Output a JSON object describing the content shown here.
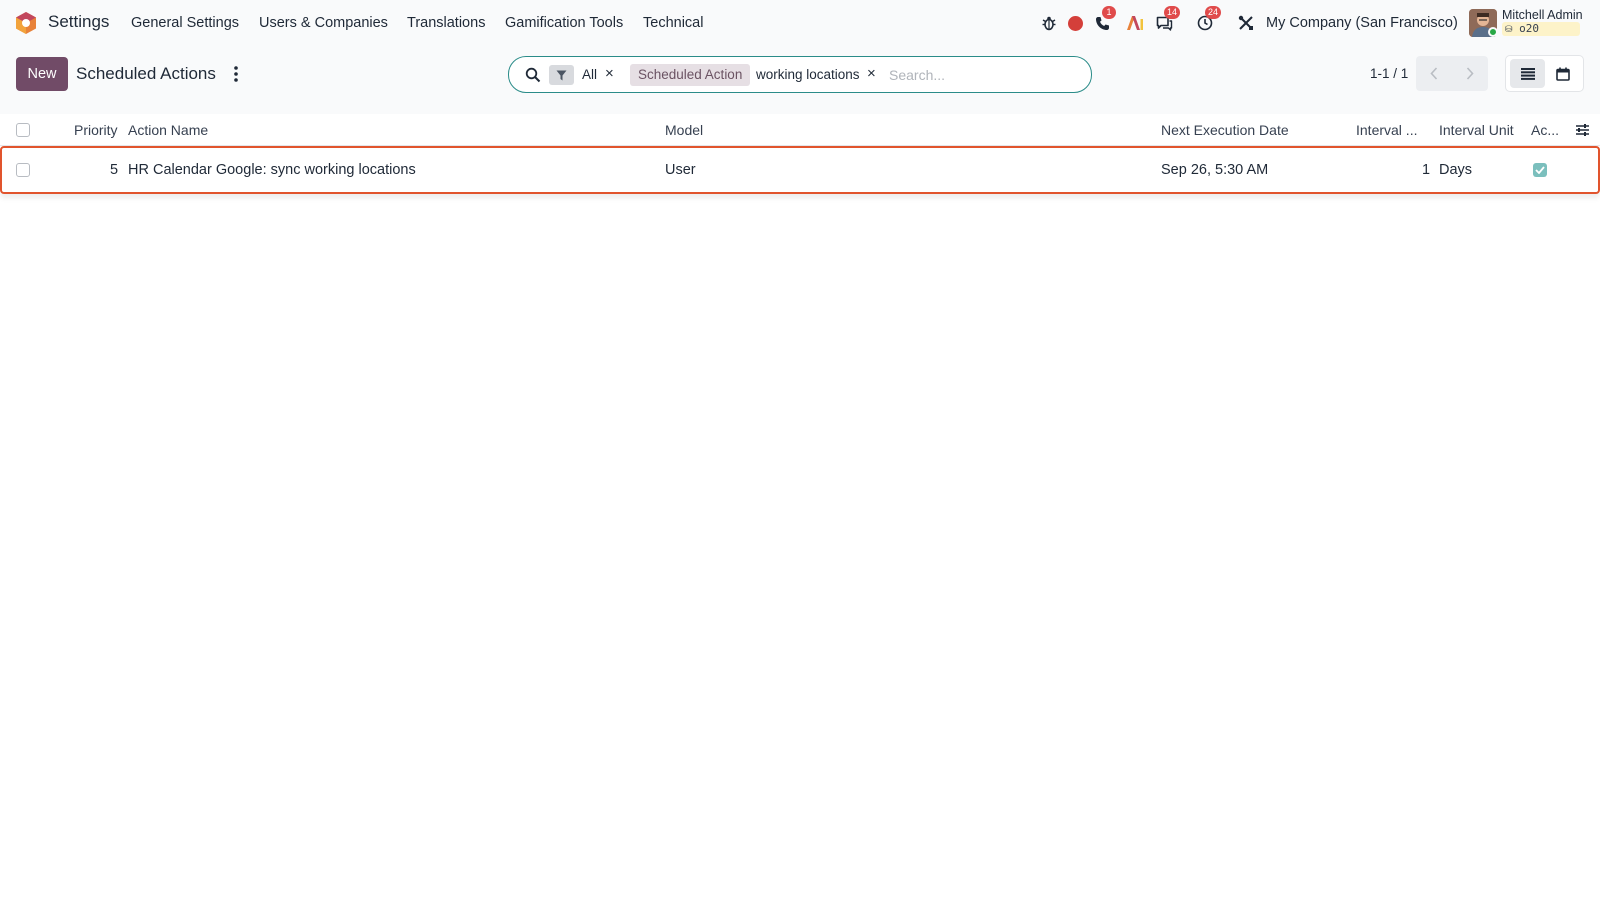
{
  "navbar": {
    "app_name": "Settings",
    "menu": [
      "General Settings",
      "Users & Companies",
      "Translations",
      "Gamification Tools",
      "Technical"
    ],
    "icons": {
      "debug": "bug-icon",
      "record": "record-icon",
      "phone": "phone-icon",
      "ai": "ai-icon",
      "chat": "chat-icon",
      "activity": "clock-icon",
      "tools": "tools-icon"
    },
    "badges": {
      "phone": "1",
      "chat": "14",
      "activity": "24"
    },
    "company": "My Company (San Francisco)",
    "user_name": "Mitchell Admin",
    "database": "o20",
    "colors": {
      "record": "#d43f3a",
      "badge": "#e04b4b",
      "brand": "#714b67",
      "highlight": "#e1542d"
    }
  },
  "control_panel": {
    "new_label": "New",
    "title": "Scheduled Actions",
    "search": {
      "filter_facet": "All",
      "group_facet_label": "Scheduled Action",
      "group_facet_value": "working locations",
      "placeholder": "Search..."
    },
    "pager": "1-1 / 1",
    "views": [
      "list-view-icon",
      "calendar-view-icon"
    ]
  },
  "table": {
    "columns": [
      "Priority",
      "Action Name",
      "Model",
      "Next Execution Date",
      "Interval ...",
      "Interval Unit",
      "Ac..."
    ],
    "rows": [
      {
        "priority": "5",
        "action_name": "HR Calendar Google: sync working locations",
        "model": "User",
        "next_execution": "Sep 26, 5:30 AM",
        "interval_number": "1",
        "interval_unit": "Days",
        "active": true
      }
    ]
  }
}
